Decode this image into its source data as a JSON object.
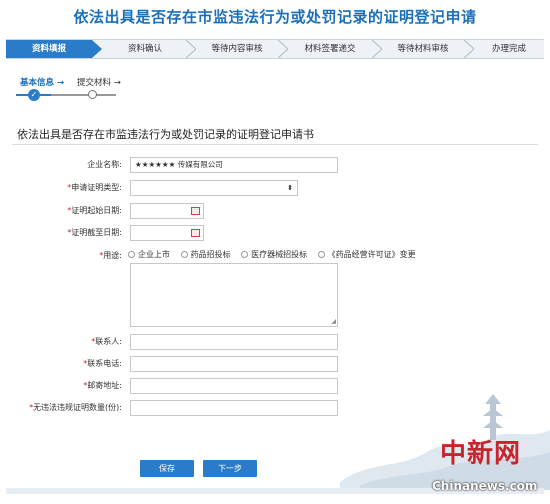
{
  "page": {
    "title": "依法出具是否存在市监违法行为或处罚记录的证明登记申请"
  },
  "steps": [
    {
      "label": "资料填报",
      "active": true
    },
    {
      "label": "资料确认",
      "active": false
    },
    {
      "label": "等待内容审核",
      "active": false
    },
    {
      "label": "材料签署递交",
      "active": false
    },
    {
      "label": "等待材料审核",
      "active": false
    },
    {
      "label": "办理完成",
      "active": false
    }
  ],
  "substeps": [
    {
      "label": "基本信息",
      "arrow": "→",
      "active": true
    },
    {
      "label": "提交材料",
      "arrow": "→",
      "active": false
    }
  ],
  "form": {
    "title": "依法出具是否存在市监违法行为或处罚记录的证明登记申请书",
    "required_mark": "*",
    "fields": {
      "company": {
        "label": "企业名称:",
        "value": "★★★★★★ 传媒有限公司"
      },
      "cert_type": {
        "label": "申请证明类型:",
        "value": ""
      },
      "start_date": {
        "label": "证明起始日期:",
        "value": ""
      },
      "end_date": {
        "label": "证明截至日期:",
        "value": ""
      },
      "purpose": {
        "label": "用途:",
        "options": [
          "企业上市",
          "药品招投标",
          "医疗器械招投标",
          "《药品经营许可证》变更"
        ]
      },
      "contact": {
        "label": "联系人:",
        "value": ""
      },
      "phone": {
        "label": "联系电话:",
        "value": ""
      },
      "address": {
        "label": "邮寄地址:",
        "value": ""
      },
      "copies": {
        "label": "无违法违规证明数量(份):",
        "value": ""
      }
    }
  },
  "buttons": {
    "save": "保存",
    "next": "下一步"
  },
  "watermark": {
    "logo_text": "中新网",
    "site": "Chinanews.com"
  },
  "colors": {
    "accent": "#2a7cc9",
    "title": "#1b70b8",
    "required": "#d21e1e"
  }
}
